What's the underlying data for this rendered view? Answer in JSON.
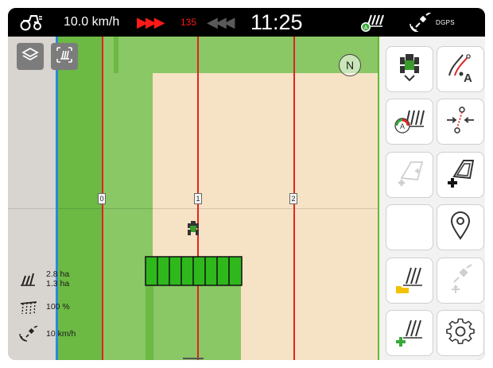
{
  "status_bar": {
    "tractor_icon": "tractor-icon",
    "speed": "10.0 km/h",
    "steer_right_arrows": "▶▶▶",
    "deviation_cm": "135",
    "steer_left_arrows": "◀◀◀",
    "clock": "11:25",
    "section_control_icon": "section-control-icon",
    "gnss_icon": "satellite-icon",
    "gnss_signal": "DGPS"
  },
  "map": {
    "layers_icon": "layers-icon",
    "view_icon": "map-view-icon",
    "compass_label": "N",
    "tracks": [
      "0",
      "1",
      "2"
    ],
    "vehicle_icon": "tractor-top-icon",
    "colors": {
      "field_unworked": "#f6e3c5",
      "field_worked": "#8ac765",
      "headland": "#6cb944",
      "guidance_line": "#e32323",
      "boundary_line": "#2a8ad8",
      "boom": "#2eb81c"
    }
  },
  "stats": {
    "area_total": "2.8 ha",
    "area_worked": "1.3 ha",
    "rate": "100 %",
    "speed": "10 km/h"
  },
  "buttons": [
    {
      "id": "vehicle-settings",
      "icon": "tractor-settings-icon"
    },
    {
      "id": "guidance-line-a",
      "icon": "guidance-line-a-icon"
    },
    {
      "id": "section-control",
      "icon": "section-control-icon"
    },
    {
      "id": "point-to-point",
      "icon": "point-relocation-icon"
    },
    {
      "id": "add-boundary",
      "icon": "add-boundary-icon"
    },
    {
      "id": "add-obstacle",
      "icon": "add-obstacle-icon"
    },
    {
      "id": "empty-slot",
      "icon": ""
    },
    {
      "id": "set-marker",
      "icon": "location-pin-icon"
    },
    {
      "id": "open-field",
      "icon": "field-folder-icon"
    },
    {
      "id": "gnss-info",
      "icon": "satellite-icon"
    },
    {
      "id": "new-field",
      "icon": "new-field-icon"
    },
    {
      "id": "settings",
      "icon": "gear-icon"
    }
  ]
}
